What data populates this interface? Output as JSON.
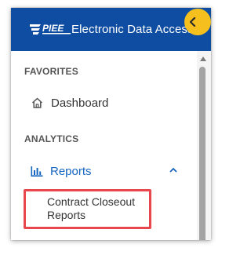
{
  "header": {
    "logo_text": "PIEE",
    "app_title": "Electronic Data Access",
    "collapse_icon": "chevron-left-icon"
  },
  "sidebar": {
    "sections": [
      {
        "heading": "FAVORITES",
        "items": [
          {
            "label": "Dashboard",
            "icon": "home-icon"
          }
        ]
      },
      {
        "heading": "ANALYTICS",
        "items": [
          {
            "label": "Reports",
            "icon": "bar-chart-icon",
            "expanded": true,
            "children": [
              {
                "label": "Contract Closeout Reports"
              }
            ]
          }
        ]
      }
    ]
  },
  "colors": {
    "header_bg": "#0e4da1",
    "accent_button": "#f5c01e",
    "active_link": "#1565c0",
    "highlight_border": "#e8474d",
    "text_primary": "#333333",
    "heading_text": "#555555"
  }
}
